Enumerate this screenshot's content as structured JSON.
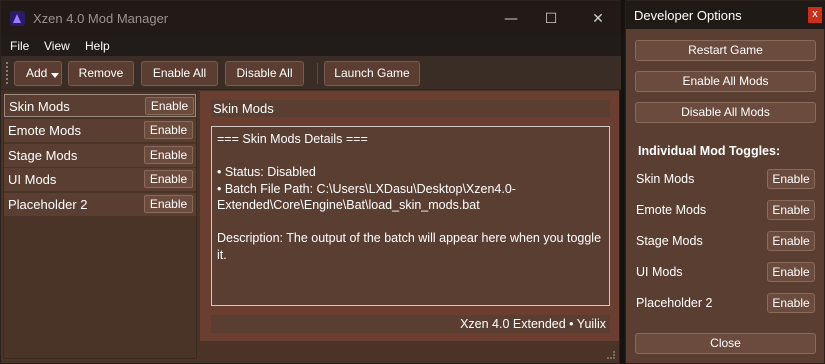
{
  "main_window": {
    "title": "Xzen 4.0 Mod Manager",
    "controls": {
      "minimize": "—",
      "maximize": "☐",
      "close": "✕"
    }
  },
  "menu": [
    "File",
    "View",
    "Help"
  ],
  "toolbar": {
    "add": "Add",
    "remove": "Remove",
    "enable_all": "Enable All",
    "disable_all": "Disable All",
    "launch_game": "Launch Game"
  },
  "mods": [
    {
      "name": "Skin Mods",
      "action": "Enable"
    },
    {
      "name": "Emote Mods",
      "action": "Enable"
    },
    {
      "name": "Stage Mods",
      "action": "Enable"
    },
    {
      "name": "UI Mods",
      "action": "Enable"
    },
    {
      "name": "Placeholder 2",
      "action": "Enable"
    }
  ],
  "details": {
    "header": "Skin Mods",
    "text": "=== Skin Mods Details ===\n\n• Status: Disabled\n• Batch File Path: C:\\Users\\LXDasu\\Desktop\\Xzen4.0-Extended\\Core\\Engine\\Bat\\load_skin_mods.bat\n\nDescription: The output of the batch will appear here when you toggle it.",
    "footer": "Xzen 4.0 Extended  •  Yuilix"
  },
  "dev_window": {
    "title": "Developer Options",
    "close": "x",
    "restart": "Restart Game",
    "enable_all": "Enable All Mods",
    "disable_all": "Disable All Mods",
    "toggles_heading": "Individual Mod Toggles:",
    "toggles": [
      {
        "name": "Skin Mods",
        "action": "Enable"
      },
      {
        "name": "Emote Mods",
        "action": "Enable"
      },
      {
        "name": "Stage Mods",
        "action": "Enable"
      },
      {
        "name": "UI Mods",
        "action": "Enable"
      },
      {
        "name": "Placeholder 2",
        "action": "Enable"
      }
    ],
    "close_button": "Close"
  },
  "colors": {
    "window_bg": "#4a3428",
    "panel_bg": "#5a3e32",
    "button_bg": "#6b4b3d",
    "titlebar_bg": "#221a16",
    "close_accent": "#c8301c"
  }
}
